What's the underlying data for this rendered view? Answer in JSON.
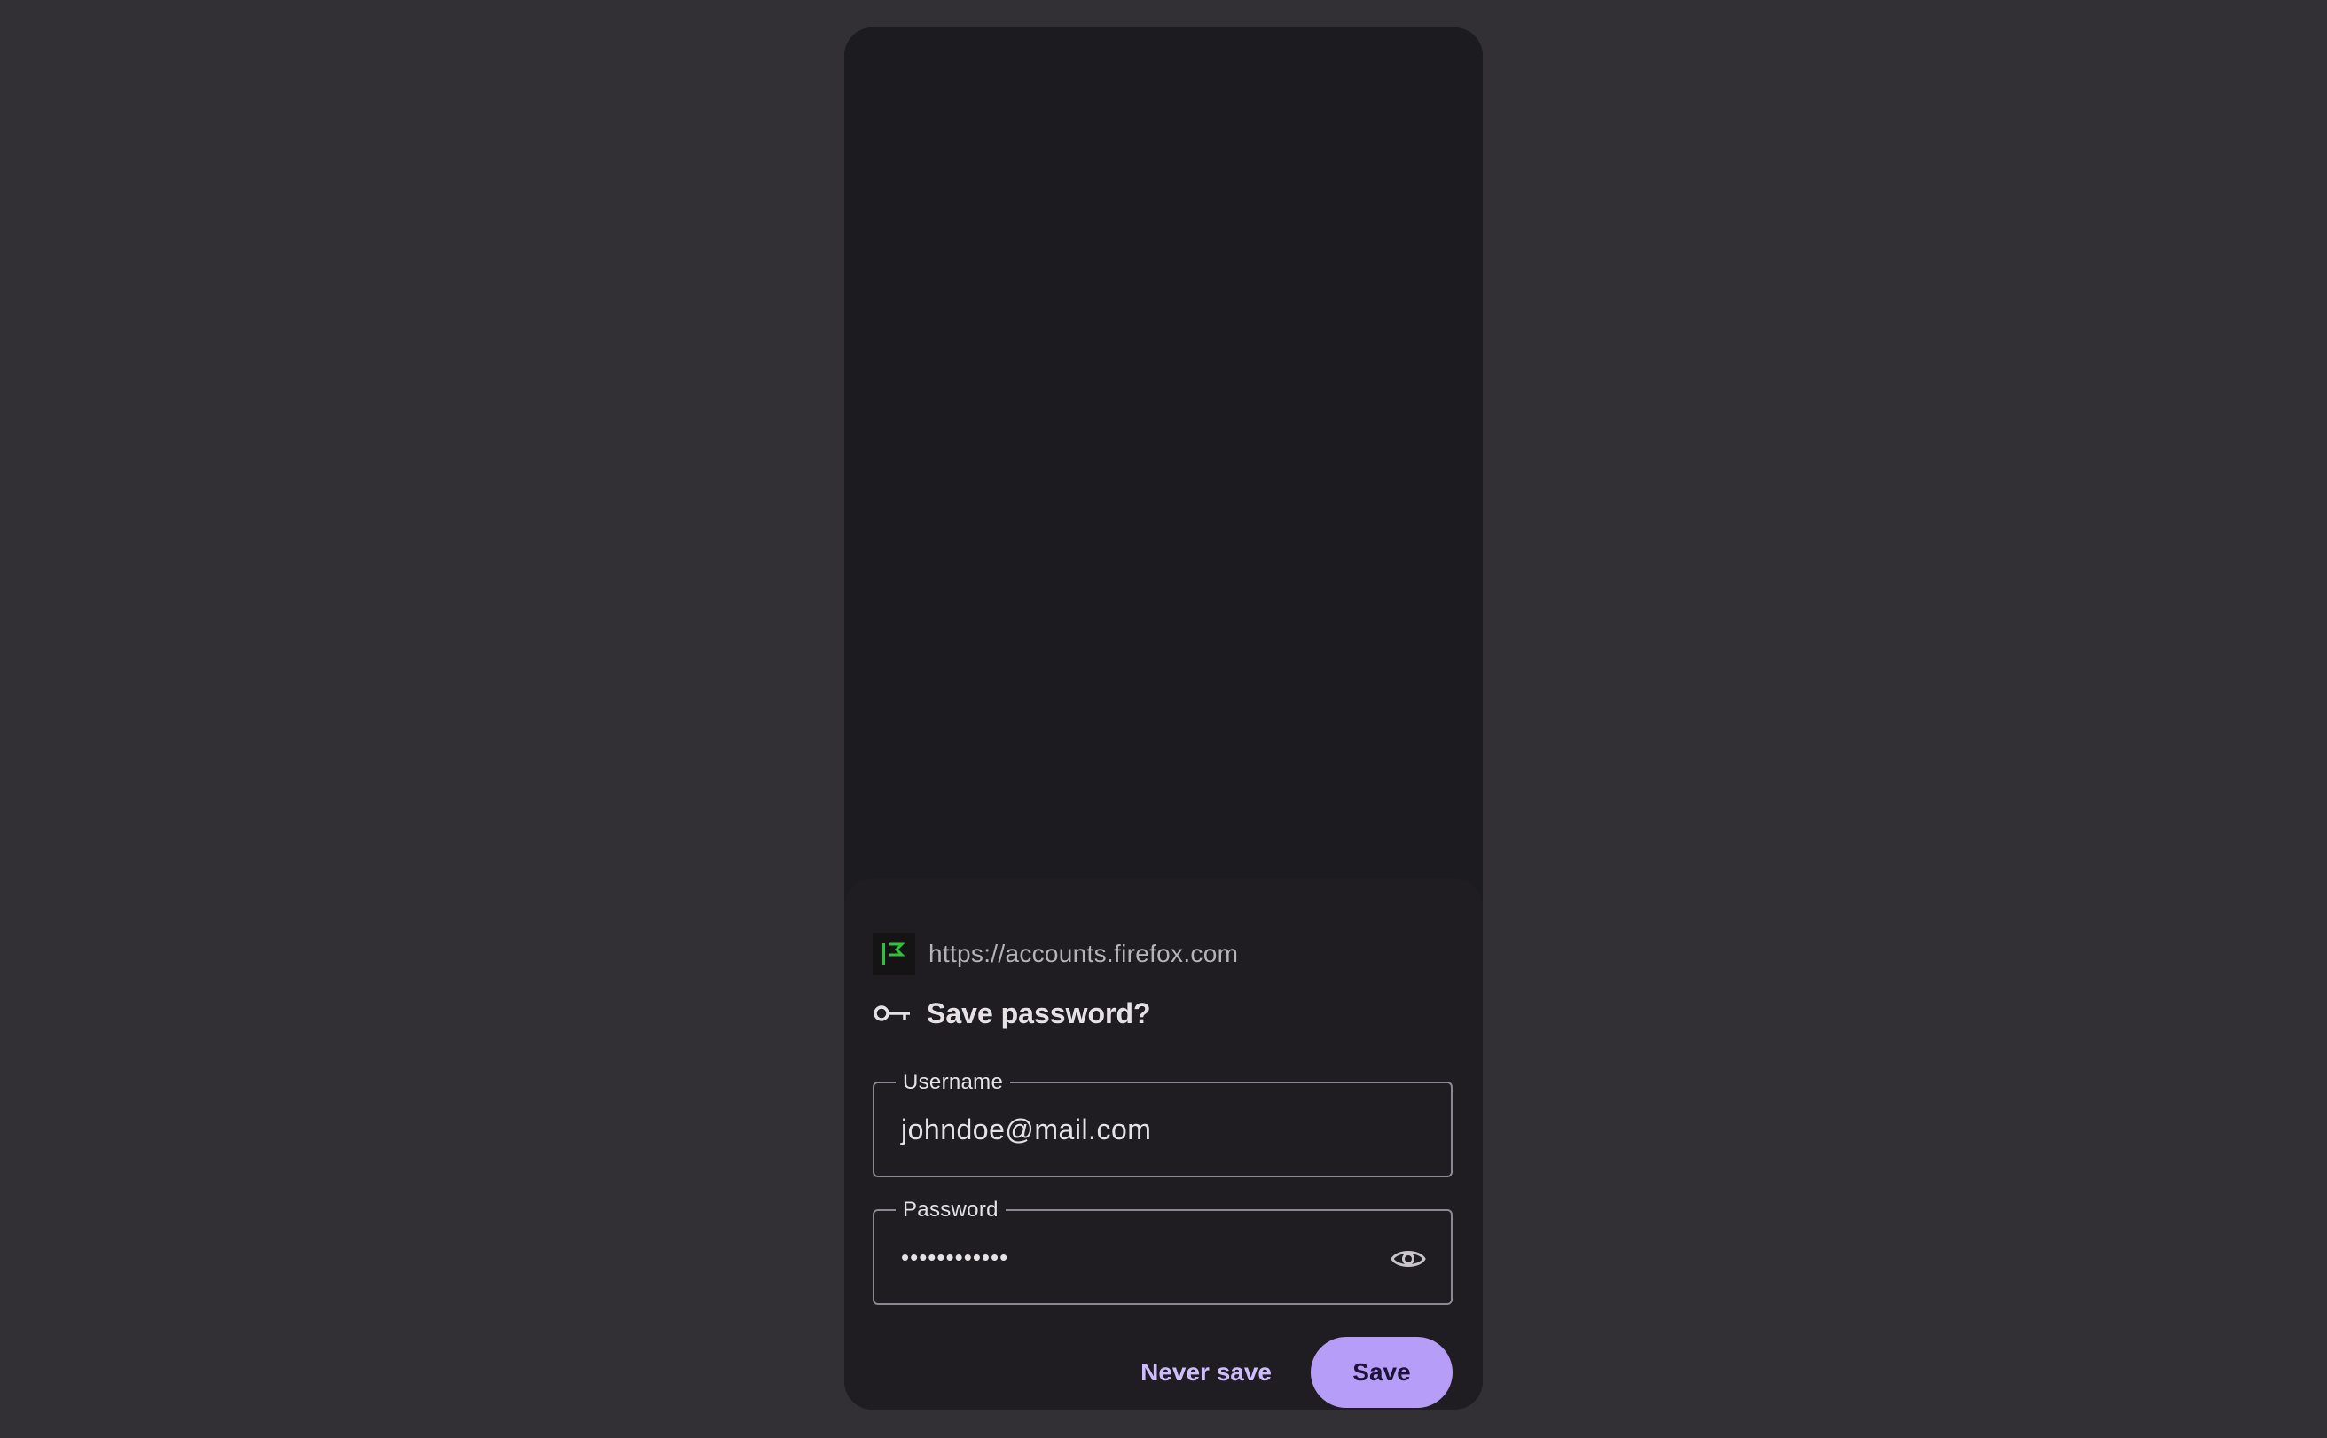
{
  "prompt": {
    "origin": "https://accounts.firefox.com",
    "title": "Save password?",
    "username": {
      "label": "Username",
      "value": "johndoe@mail.com"
    },
    "password": {
      "label": "Password",
      "value": "••••••••••••"
    },
    "actions": {
      "never_save": "Never save",
      "save": "Save"
    }
  },
  "icons": {
    "favicon": "firefox-accounts-favicon",
    "title": "key-icon",
    "password_toggle": "eye-icon"
  },
  "colors": {
    "background": "#322f35",
    "surface": "#1c1b1f",
    "sheet": "#1f1d22",
    "accent": "#b69df8",
    "accent_text": "#cfbcff",
    "favicon_green": "#2ec13a"
  }
}
